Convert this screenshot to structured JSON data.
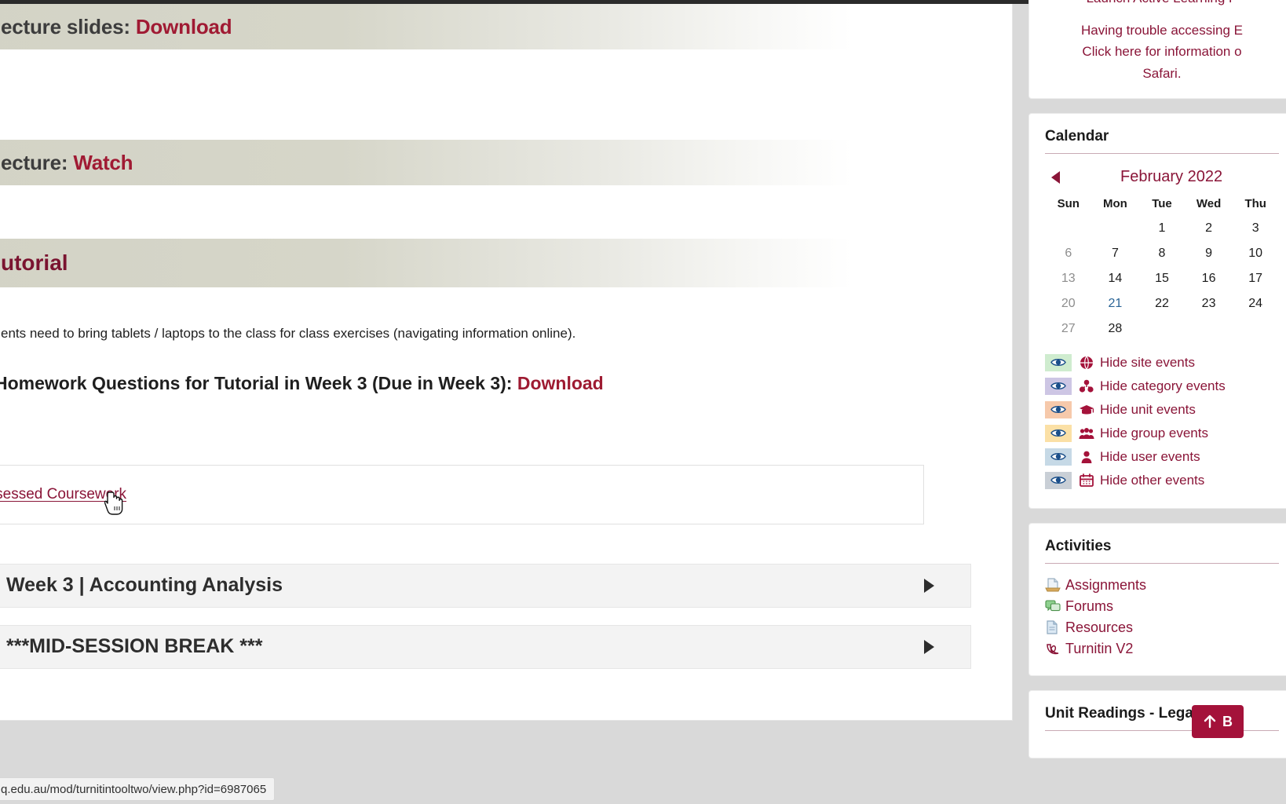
{
  "main": {
    "banners": [
      {
        "prefix": "ecture slides: ",
        "accent": "Download",
        "name": "lecture-slides-banner"
      },
      {
        "prefix": "ecture: ",
        "accent": "Watch",
        "name": "lecture-watch-banner"
      }
    ],
    "tutorial_heading": "utorial",
    "tutorial_note": "ents need to bring tablets / laptops to the class for class exercises (navigating information online).",
    "homework": {
      "text": "Homework Questions for Tutorial in Week 3 (Due in Week 3): ",
      "download_label": "Download"
    },
    "assessed_coursework_label": "Assessed Coursework",
    "sections": [
      {
        "title": "Week 3 | Accounting Analysis"
      },
      {
        "title": "***MID-SESSION BREAK ***"
      }
    ]
  },
  "sidebar": {
    "notice": {
      "line1": "Launch Active Learning P",
      "line2": "Having trouble accessing E",
      "line3": "Click here for information o",
      "line4": "Safari."
    },
    "calendar": {
      "title": "Calendar",
      "month": "February 2022",
      "prev_label": "Previous month",
      "weekdays": [
        "Sun",
        "Mon",
        "Tue",
        "Wed",
        "Thu"
      ],
      "weeks": [
        [
          "",
          "",
          "1",
          "2",
          "3"
        ],
        [
          "6",
          "7",
          "8",
          "9",
          "10"
        ],
        [
          "13",
          "14",
          "15",
          "16",
          "17"
        ],
        [
          "20",
          "21",
          "22",
          "23",
          "24"
        ],
        [
          "27",
          "28",
          "",
          "",
          ""
        ]
      ],
      "today": "21",
      "weekend_days": [
        "6",
        "13",
        "20",
        "27"
      ],
      "filters": [
        {
          "label": "Hide site events",
          "icon": "globe-icon",
          "swatch": "#cfeccf"
        },
        {
          "label": "Hide category events",
          "icon": "category-icon",
          "swatch": "#cdc6e4"
        },
        {
          "label": "Hide unit events",
          "icon": "graduation-cap-icon",
          "swatch": "#f6c9ab"
        },
        {
          "label": "Hide group events",
          "icon": "group-icon",
          "swatch": "#fbe0a6"
        },
        {
          "label": "Hide user events",
          "icon": "user-icon",
          "swatch": "#c6d9e6"
        },
        {
          "label": "Hide other events",
          "icon": "calendar-icon",
          "swatch": "#c9cfd6"
        }
      ]
    },
    "activities": {
      "title": "Activities",
      "items": [
        {
          "label": "Assignments",
          "icon": "assignment-icon"
        },
        {
          "label": "Forums",
          "icon": "forum-icon"
        },
        {
          "label": "Resources",
          "icon": "resource-icon"
        },
        {
          "label": "Turnitin V2",
          "icon": "turnitin-icon"
        }
      ]
    },
    "unit_readings": {
      "title": "Unit Readings - Legan"
    },
    "back_to_top": "B"
  },
  "browser": {
    "status_url": "q.edu.au/mod/turnitintooltwo/view.php?id=6987065"
  },
  "colors": {
    "brand_red": "#8a1538",
    "accent_red": "#9e1b32",
    "banner_khaki": "#d3d3c6",
    "today_blue": "#2a6496",
    "page_bg": "#d9d9d9"
  }
}
